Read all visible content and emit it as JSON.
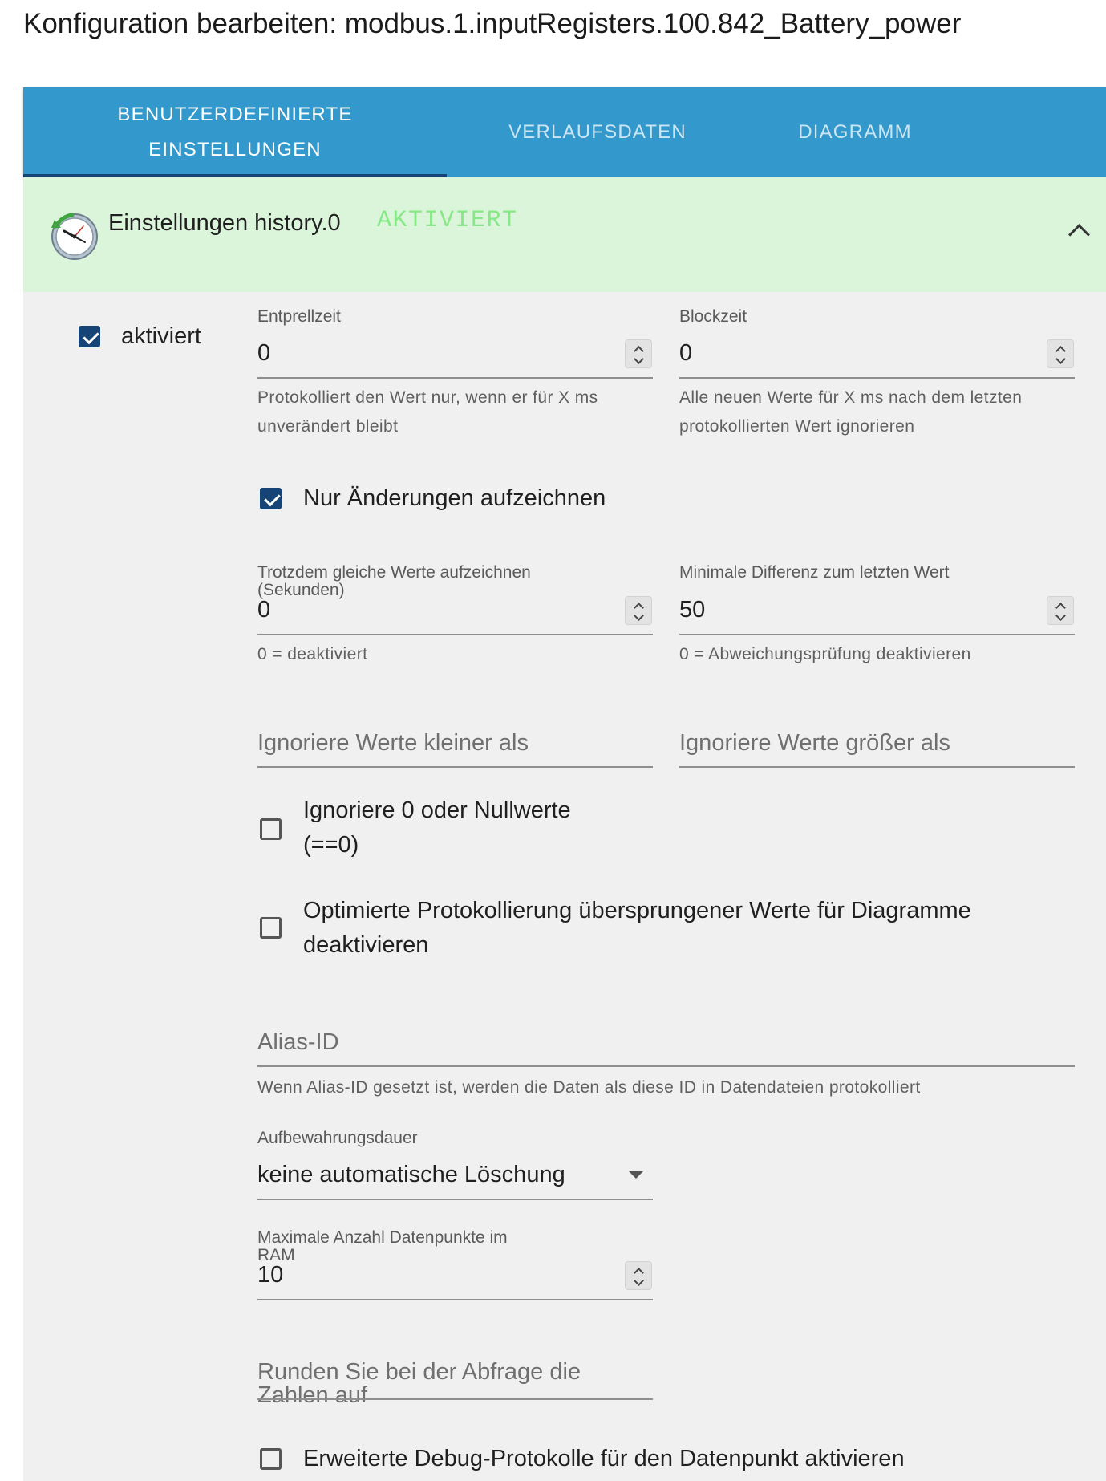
{
  "page": {
    "title": "Konfiguration bearbeiten: modbus.1.inputRegisters.100.842_Battery_power"
  },
  "tabs": [
    {
      "label_line1": "BENUTZERDEFINIERTE",
      "label_line2": "EINSTELLUNGEN",
      "active": true
    },
    {
      "label": "VERLAUFSDATEN",
      "active": false
    },
    {
      "label": "DIAGRAMM",
      "active": false
    }
  ],
  "panel": {
    "title": "Einstellungen history.0",
    "status": "AKTIVIERT",
    "icon": "history-clock-icon",
    "header_color": "#dbf5db",
    "status_color": "#86e886"
  },
  "settings": {
    "enabled": {
      "label": "aktiviert",
      "checked": true
    },
    "debounce": {
      "label": "Entprellzeit",
      "value": "0",
      "helper": "Protokolliert den Wert nur, wenn er für X ms unverändert bleibt"
    },
    "block_time": {
      "label": "Blockzeit",
      "value": "0",
      "helper": "Alle neuen Werte für X ms nach dem letzten protokollierten Wert ignorieren"
    },
    "changes_only": {
      "label": "Nur Änderungen aufzeichnen",
      "checked": true
    },
    "still_record_same": {
      "label": "Trotzdem gleiche Werte aufzeichnen (Sekunden)",
      "value": "0",
      "helper": "0 = deaktiviert"
    },
    "min_difference": {
      "label": "Minimale Differenz zum letzten Wert",
      "value": "50",
      "helper": "0 = Abweichungsprüfung deaktivieren"
    },
    "ignore_below": {
      "placeholder": "Ignoriere Werte kleiner als"
    },
    "ignore_above": {
      "placeholder": "Ignoriere Werte größer als"
    },
    "ignore_zero": {
      "label": "Ignoriere 0 oder Nullwerte (==0)",
      "checked": false
    },
    "disable_skipped": {
      "label": "Optimierte Protokollierung übersprungener Werte für Diagramme deaktivieren",
      "checked": false
    },
    "alias_id": {
      "placeholder": "Alias-ID",
      "helper": "Wenn Alias-ID gesetzt ist, werden die Daten als diese ID in Datendateien protokolliert"
    },
    "retention": {
      "label": "Aufbewahrungsdauer",
      "value": "keine automatische Löschung"
    },
    "max_ram_points": {
      "label": "Maximale Anzahl Datenpunkte im RAM",
      "value": "10"
    },
    "round_numbers": {
      "placeholder": "Runden Sie bei der Abfrage die Zahlen auf"
    },
    "debug_logs": {
      "label": "Erweiterte Debug-Protokolle für den Datenpunkt aktivieren",
      "checked": false
    }
  },
  "colors": {
    "tabbar": "#3399cc",
    "tab_indicator": "#164477",
    "checkbox_checked": "#164477",
    "body_background": "#f0f0f0"
  }
}
